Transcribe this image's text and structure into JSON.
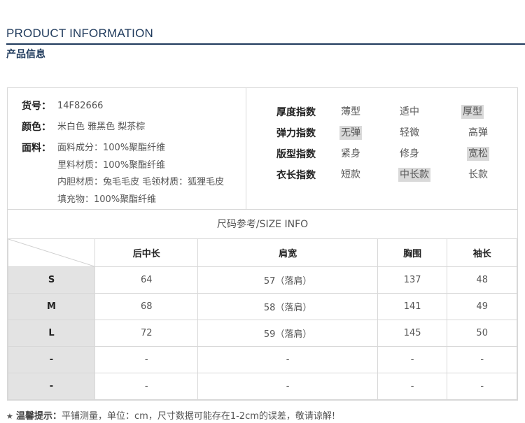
{
  "header": {
    "title_en": "PRODUCT INFORMATION",
    "title_cn": "产品信息"
  },
  "info": {
    "sku_label": "货号：",
    "sku_value": "14F82666",
    "color_label": "颜色：",
    "color_value": "米白色  雅黑色  梨茶棕",
    "material_label": "面料：",
    "material_lines": [
      "面料成分：100%聚酯纤维",
      "里料材质：100%聚酯纤维",
      "内胆材质：兔毛毛皮  毛领材质：狐狸毛皮",
      "填充物：100%聚酯纤维"
    ]
  },
  "indices": [
    {
      "label": "厚度指数",
      "options": [
        "薄型",
        "适中",
        "厚型"
      ],
      "selected": 2
    },
    {
      "label": "弹力指数",
      "options": [
        "无弹",
        "轻微",
        "高弹"
      ],
      "selected": 0
    },
    {
      "label": "版型指数",
      "options": [
        "紧身",
        "修身",
        "宽松"
      ],
      "selected": 2
    },
    {
      "label": "衣长指数",
      "options": [
        "短款",
        "中长款",
        "长款"
      ],
      "selected": 1
    }
  ],
  "size_info": {
    "header": "尺码参考/SIZE INFO",
    "columns": [
      "后中长",
      "肩宽",
      "胸围",
      "袖长"
    ],
    "rows": [
      {
        "size": "S",
        "values": [
          "64",
          "57（落肩）",
          "137",
          "48"
        ]
      },
      {
        "size": "M",
        "values": [
          "68",
          "58（落肩）",
          "141",
          "49"
        ]
      },
      {
        "size": "L",
        "values": [
          "72",
          "59（落肩）",
          "145",
          "50"
        ]
      },
      {
        "size": "-",
        "values": [
          "-",
          "-",
          "-",
          "-"
        ]
      },
      {
        "size": "-",
        "values": [
          "-",
          "-",
          "-",
          "-"
        ]
      }
    ]
  },
  "tip": {
    "star": "★",
    "label": "温馨提示：",
    "text": "平铺测量，单位：cm，尺寸数据可能存在1-2cm的误差，敬请谅解!"
  }
}
